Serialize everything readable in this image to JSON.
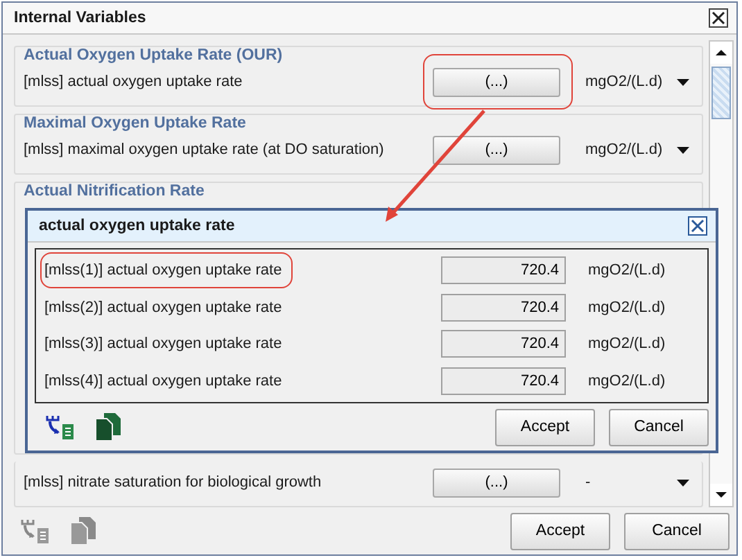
{
  "window": {
    "title": "Internal Variables"
  },
  "groups": [
    {
      "title": "Actual Oxygen Uptake Rate (OUR)",
      "rows": [
        {
          "label": "[mlss] actual oxygen uptake rate",
          "button": "(...)",
          "unit": "mgO2/(L.d)",
          "highlighted": true
        }
      ]
    },
    {
      "title": "Maximal Oxygen Uptake Rate",
      "rows": [
        {
          "label": "[mlss] maximal oxygen uptake rate (at DO saturation)",
          "button": "(...)",
          "unit": "mgO2/(L.d)",
          "highlighted": false
        }
      ]
    },
    {
      "title": "Actual Nitrification Rate"
    },
    {
      "rows": [
        {
          "label": "[mlss] nitrate saturation for biological growth",
          "button": "(...)",
          "unit": "-",
          "highlighted": false
        }
      ]
    }
  ],
  "tools": [
    {
      "kind": "import",
      "disabled": true
    },
    {
      "kind": "copy",
      "disabled": true
    }
  ],
  "buttons": [
    "Accept",
    "Cancel"
  ],
  "popup": {
    "title": "actual oxygen uptake rate",
    "rows": [
      {
        "label": "[mlss(1)] actual oxygen uptake rate",
        "value": "720.4",
        "unit": "mgO2/(L.d)",
        "highlighted": true
      },
      {
        "label": "[mlss(2)] actual oxygen uptake rate",
        "value": "720.4",
        "unit": "mgO2/(L.d)",
        "highlighted": false
      },
      {
        "label": "[mlss(3)] actual oxygen uptake rate",
        "value": "720.4",
        "unit": "mgO2/(L.d)",
        "highlighted": false
      },
      {
        "label": "[mlss(4)] actual oxygen uptake rate",
        "value": "720.4",
        "unit": "mgO2/(L.d)",
        "highlighted": false
      }
    ],
    "tools": [
      {
        "kind": "import",
        "disabled": false
      },
      {
        "kind": "copy",
        "disabled": false
      }
    ],
    "buttons": [
      "Accept",
      "Cancel"
    ]
  }
}
